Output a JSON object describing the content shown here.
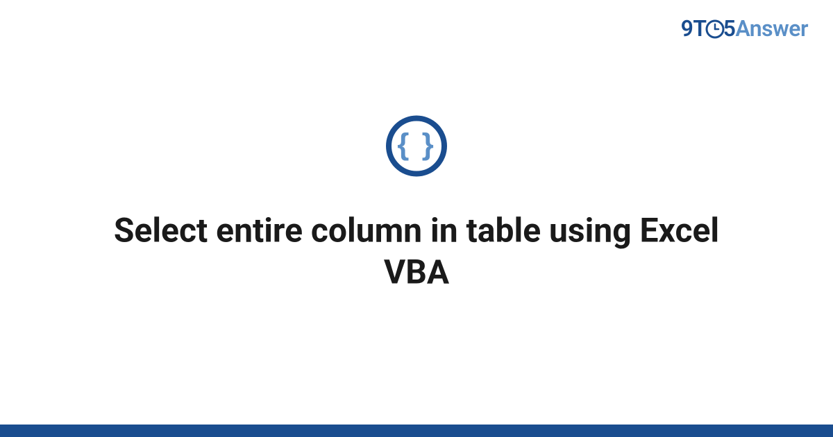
{
  "logo": {
    "part1": "9T",
    "part2": "5",
    "part3": "Answer"
  },
  "icon": {
    "glyph": "{ }"
  },
  "title": "Select entire column in table using Excel VBA",
  "colors": {
    "primary": "#1a4d8f",
    "secondary": "#5a8fc7"
  }
}
